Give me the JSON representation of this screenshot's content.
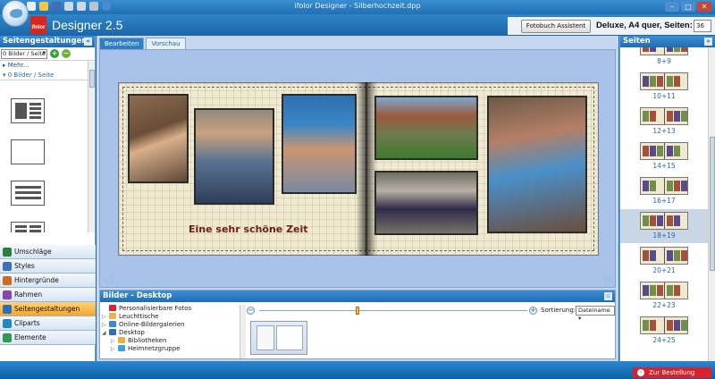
{
  "window": {
    "title": "ifolor Designer - Silberhochzeit.dpp",
    "controls": [
      "–",
      "□",
      "✕"
    ]
  },
  "header": {
    "logo_text": "ifolor",
    "app_title": "Designer 2.5",
    "wizard_button": "Fotobuch Assistent",
    "product": "Deluxe, A4 quer, Seiten:",
    "pages_value": "36"
  },
  "left_panel": {
    "title": "Seitengestaltungen",
    "filter_select": "0 Bilder / Seite",
    "add": "+",
    "remove": "−",
    "rows": [
      "Mehr...",
      "0 Bilder / Seite"
    ],
    "nav": [
      {
        "label": "Umschläge",
        "icon": "cover-icon",
        "color": "#2f7f3b"
      },
      {
        "label": "Styles",
        "icon": "styles-icon",
        "color": "#3b6fc0"
      },
      {
        "label": "Hintergründe",
        "icon": "backgrounds-icon",
        "color": "#d06a1f"
      },
      {
        "label": "Rahmen",
        "icon": "frames-icon",
        "color": "#8a45b0"
      },
      {
        "label": "Seitengestaltungen",
        "icon": "page-layout-icon",
        "color": "#2a6ebd",
        "active": true
      },
      {
        "label": "Cliparts",
        "icon": "cliparts-icon",
        "color": "#1f88c8"
      },
      {
        "label": "Elemente",
        "icon": "elements-icon",
        "color": "#2f9a4a"
      }
    ]
  },
  "center": {
    "tabs": [
      "Bearbeiten",
      "Vorschau"
    ],
    "book_caption": "Eine sehr schöne Zeit"
  },
  "images_panel": {
    "title": "Bilder - Desktop",
    "tree": [
      {
        "label": "Personalisierbare Fotos",
        "indent": 0,
        "color": "#d8232a",
        "exp": ""
      },
      {
        "label": "Leuchttische",
        "indent": 0,
        "color": "#e3b74b",
        "exp": "▷"
      },
      {
        "label": "Online-Bildergalerien",
        "indent": 0,
        "color": "#3b8ad0",
        "exp": "▷"
      },
      {
        "label": "Desktop",
        "indent": 0,
        "color": "#2d6fb8",
        "exp": "◢"
      },
      {
        "label": "Bibliotheken",
        "indent": 1,
        "color": "#e2b24a",
        "exp": "▷"
      },
      {
        "label": "Heimnetzgruppe",
        "indent": 1,
        "color": "#3ea3d9",
        "exp": "▷"
      }
    ],
    "sort_label": "Sortierung:",
    "sort_value": "Dateiname",
    "zoom_minus": "−",
    "zoom_plus": "+",
    "zoom_level": 0.36
  },
  "right_panel": {
    "title": "Seiten",
    "spreads": [
      "8+9",
      "10+11",
      "12+13",
      "14+15",
      "16+17",
      "18+19",
      "20+21",
      "22+23",
      "24+25"
    ],
    "selected": "18+19"
  },
  "statusbar": {
    "order_button": "Zur Bestellung"
  }
}
